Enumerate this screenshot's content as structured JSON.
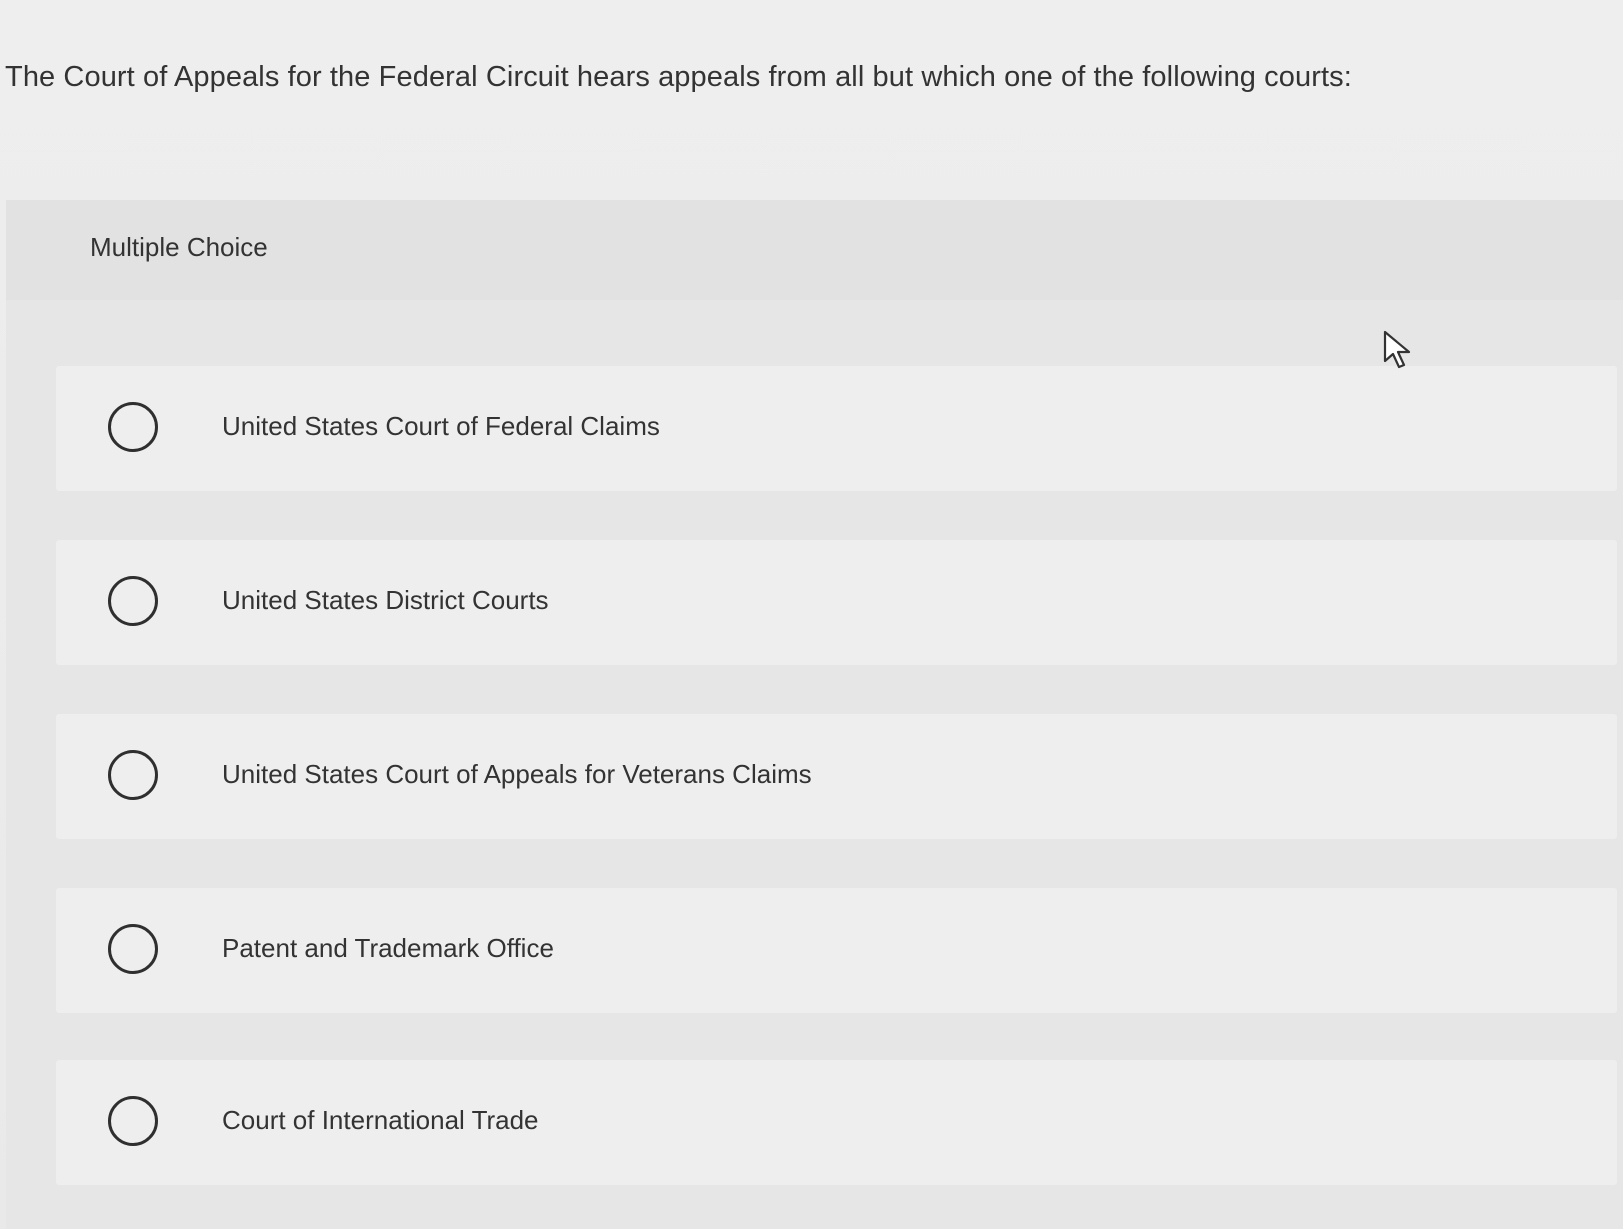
{
  "question": {
    "text": "The Court of Appeals for the Federal Circuit hears appeals from all but which one of the following courts:"
  },
  "panel": {
    "title": "Multiple Choice"
  },
  "options": [
    {
      "label": "United States Court of Federal Claims"
    },
    {
      "label": "United States District Courts"
    },
    {
      "label": "United States Court of Appeals for Veterans Claims"
    },
    {
      "label": "Patent and Trademark Office"
    },
    {
      "label": "Court of International Trade"
    }
  ],
  "icons": {
    "radio": "radio-button-unselected-icon",
    "cursor": "mouse-pointer-icon"
  }
}
